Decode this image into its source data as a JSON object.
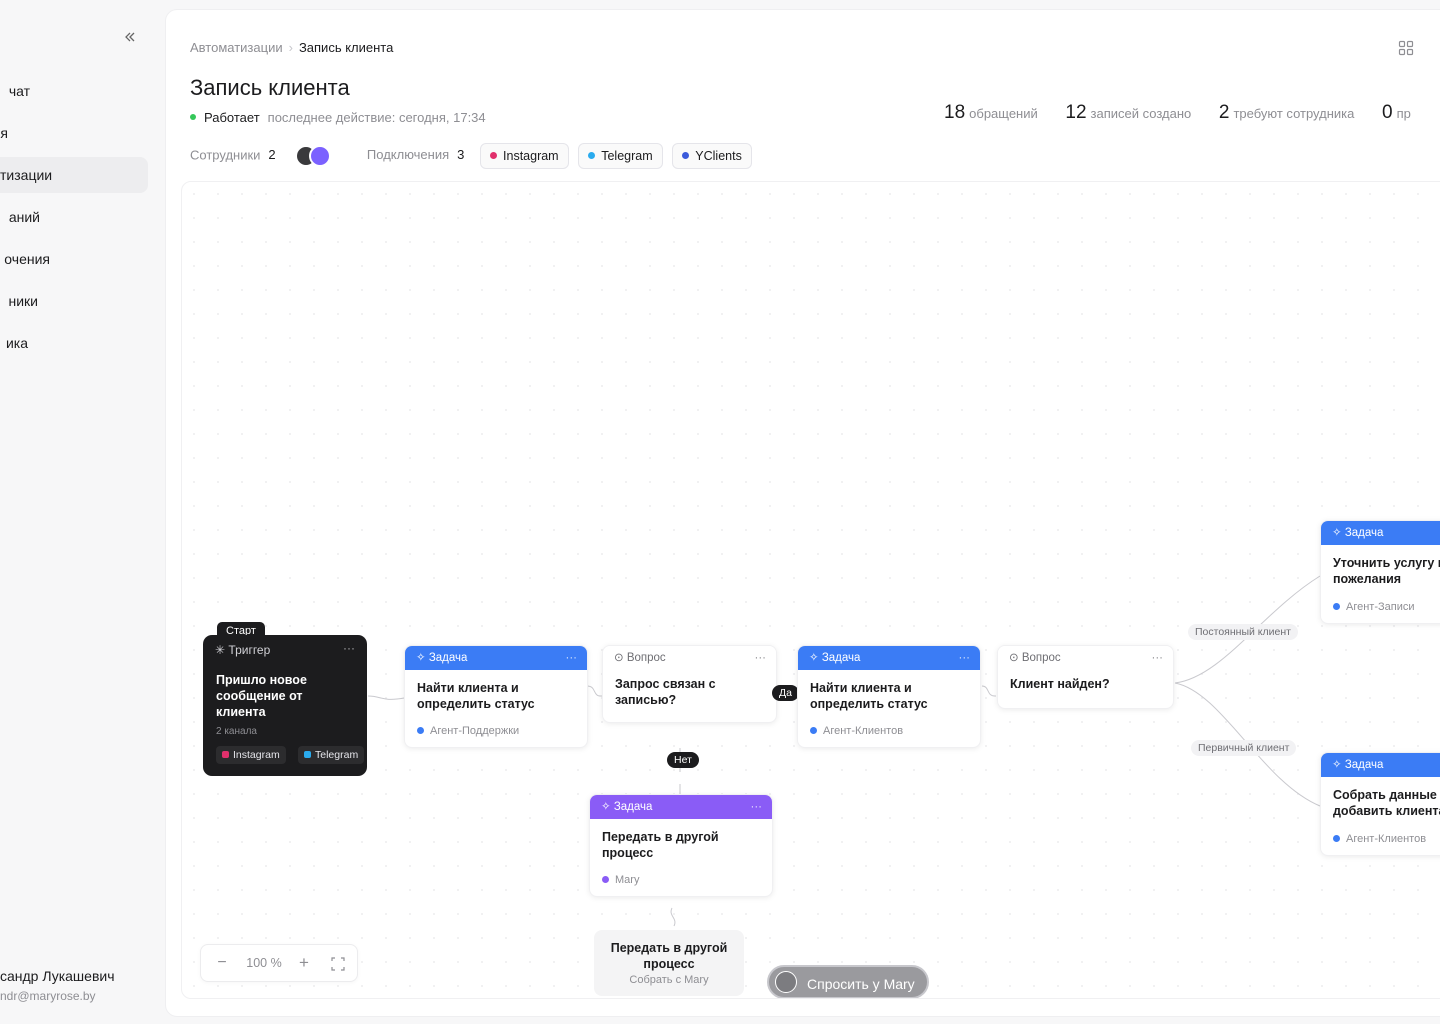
{
  "sidebar": {
    "collapse_icon": "double-chevron-left-icon",
    "items": [
      {
        "label": "чат"
      },
      {
        "label": "я"
      },
      {
        "label": "тизации",
        "active": true
      },
      {
        "label": "аний"
      },
      {
        "label": "очения"
      },
      {
        "label": "ники"
      },
      {
        "label": "ика"
      }
    ],
    "user": {
      "name": "сандр Лукашевич",
      "email": "ndr@maryrose.by"
    }
  },
  "breadcrumb": {
    "parent": "Автоматизации",
    "separator": "›",
    "current": "Запись клиента"
  },
  "page": {
    "title": "Запись клиента",
    "status": "Работает",
    "last_action": "последнее действие: сегодня, 17:34"
  },
  "stats": [
    {
      "value": "18",
      "label": "обращений"
    },
    {
      "value": "12",
      "label": "записей создано"
    },
    {
      "value": "2",
      "label": "требуют сотрудника"
    },
    {
      "value": "0",
      "label": "пр"
    }
  ],
  "info": {
    "employees_label": "Сотрудники",
    "employees_count": "2",
    "connections_label": "Подключения",
    "connections_count": "3",
    "connections": [
      {
        "name": "Instagram",
        "color": "#e1306c"
      },
      {
        "name": "Telegram",
        "color": "#2aabee"
      },
      {
        "name": "YClients",
        "color": "#3b5bdb"
      }
    ]
  },
  "flow": {
    "start": {
      "tag": "Старт",
      "type": "Триггер",
      "more": "···",
      "text": "Пришло новое сообщение от клиента",
      "sub": "2 канала",
      "channels": [
        {
          "name": "Instagram",
          "color": "#e1306c"
        },
        {
          "name": "Telegram",
          "color": "#2aabee"
        }
      ]
    },
    "task1": {
      "type": "Задача",
      "more": "···",
      "text": "Найти клиента и определить статус",
      "agent": "Агент-Поддержки"
    },
    "q1": {
      "type": "Вопрос",
      "more": "···",
      "text": "Запрос связан с записью?"
    },
    "task2": {
      "type": "Задача",
      "more": "···",
      "text": "Найти клиента и определить статус",
      "agent": "Агент-Клиентов"
    },
    "q2": {
      "type": "Вопрос",
      "more": "···",
      "text": "Клиент найден?"
    },
    "task3": {
      "type": "Задача",
      "text": "Уточнить услугу и пожелания",
      "agent": "Агент-Записи"
    },
    "task4": {
      "type": "Задача",
      "text": "Собрать данные и добавить клиента",
      "agent": "Агент-Клиентов"
    },
    "task5": {
      "type": "Задача",
      "more": "···",
      "text": "Передать в другой процесс",
      "agent": "Mary",
      "agent_color": "#8a5cf6"
    },
    "ghost": {
      "text": "Передать в другой процесс",
      "sub": "Собрать с Mary"
    },
    "labels": {
      "yes": "Да",
      "no": "Нет",
      "regular": "Постоянный клиент",
      "new": "Первичный клиент"
    }
  },
  "zoom": {
    "minus": "−",
    "level": "100 %",
    "plus": "+"
  },
  "ask": {
    "label": "Спросить у Mary"
  },
  "colors": {
    "task_blue": "#3b7cf5",
    "task_purple": "#8a5cf6",
    "status_green": "#34c759"
  }
}
